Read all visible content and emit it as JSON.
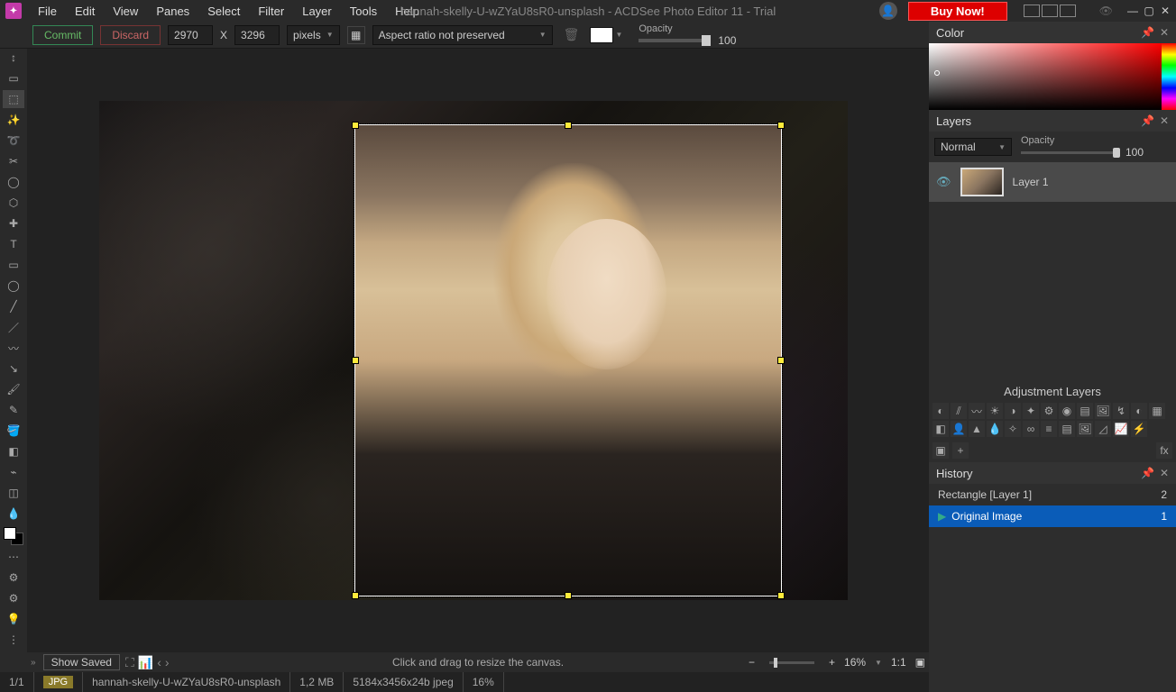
{
  "menu": {
    "items": [
      "File",
      "Edit",
      "View",
      "Panes",
      "Select",
      "Filter",
      "Layer",
      "Tools",
      "Help"
    ]
  },
  "title": "hannah-skelly-U-wZYaU8sR0-unsplash - ACDSee Photo Editor 11 - Trial",
  "buy_now": "Buy Now!",
  "optbar": {
    "commit": "Commit",
    "discard": "Discard",
    "width": "2970",
    "x": "X",
    "height": "3296",
    "units": "pixels",
    "aspect": "Aspect ratio not preserved",
    "opacity_label": "Opacity",
    "opacity_value": "100"
  },
  "hint": "Click and drag to resize the canvas.",
  "nav": {
    "show_saved": "Show Saved",
    "zoom": "16%",
    "one_to_one": "1:1"
  },
  "status": {
    "page": "1/1",
    "badge": "JPG",
    "filename": "hannah-skelly-U-wZYaU8sR0-unsplash",
    "size": "1,2 MB",
    "dims": "5184x3456x24b jpeg",
    "zoom": "16%"
  },
  "right": {
    "color_title": "Color",
    "layers_title": "Layers",
    "blend_mode": "Normal",
    "layer_opacity_label": "Opacity",
    "layer_opacity_val": "100",
    "layer_name": "Layer 1",
    "adj_title": "Adjustment Layers",
    "history_title": "History",
    "history": [
      {
        "label": "Rectangle [Layer 1]",
        "count": "2",
        "selected": false,
        "icon": false
      },
      {
        "label": "Original Image",
        "count": "1",
        "selected": true,
        "icon": true
      }
    ]
  }
}
